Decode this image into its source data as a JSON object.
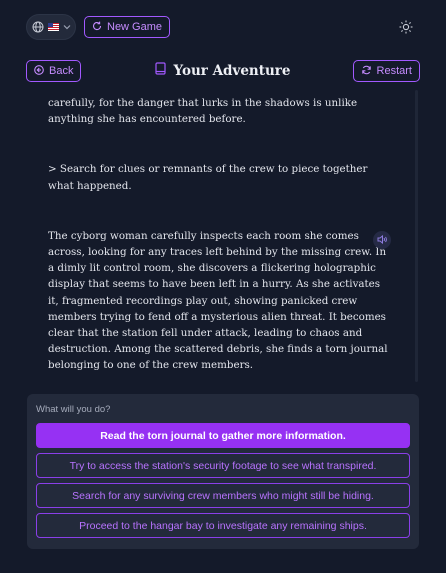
{
  "header": {
    "language_icon": "globe-icon",
    "flag_icon": "us-flag-icon",
    "new_game_label": "New Game",
    "theme_icon": "sun-icon"
  },
  "nav": {
    "back_label": "Back",
    "title": "Your Adventure",
    "restart_label": "Restart"
  },
  "story": {
    "paragraphs": [
      "carefully, for the danger that lurks in the shadows is unlike anything she has encountered before.",
      "> Search for clues or remnants of the crew to piece together what happened.",
      "The cyborg woman carefully inspects each room she comes across, looking for any traces left behind by the missing crew. In a dimly lit control room, she discovers a flickering holographic display that seems to have been left in a hurry. As she activates it, fragmented recordings play out, showing panicked crew members trying to fend off a mysterious alien threat. It becomes clear that the station fell under attack, leading to chaos and destruction. Among the scattered debris, she finds a torn journal belonging to one of the crew members."
    ]
  },
  "choices": {
    "prompt": "What will you do?",
    "options": [
      "Read the torn journal to gather more information.",
      "Try to access the station's security footage to see what transpired.",
      "Search for any surviving crew members who might still be hiding.",
      "Proceed to the hangar bay to investigate any remaining ships."
    ]
  },
  "colors": {
    "background": "#141a2a",
    "panel": "#232a3b",
    "accent": "#9631f3",
    "accent_text": "#c58cff"
  }
}
